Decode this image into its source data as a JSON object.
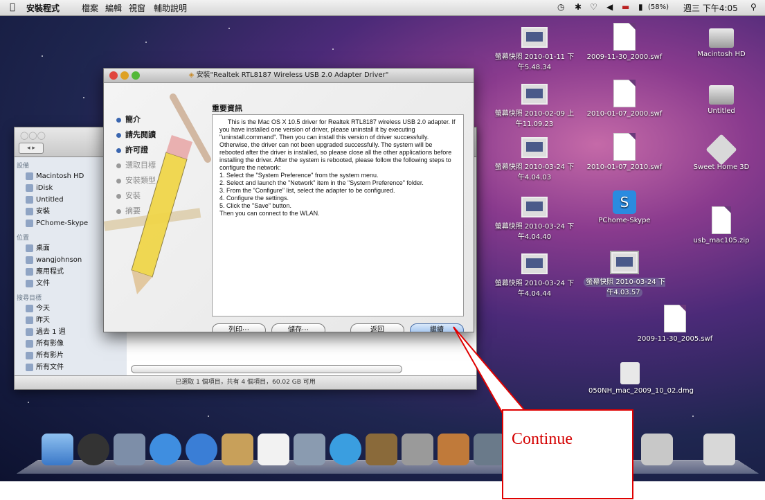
{
  "menubar": {
    "app_name": "安裝程式",
    "items": [
      "檔案",
      "編輯",
      "視窗",
      "輔助說明"
    ],
    "battery": "(58%)",
    "clock": "週三 下午4:05"
  },
  "desktop_icons": [
    {
      "label": "螢幕快照 2010-01-11 下午5.48.34",
      "type": "screenshot"
    },
    {
      "label": "2009-11-30_2000.swf",
      "type": "document"
    },
    {
      "label": "Macintosh HD",
      "type": "disk"
    },
    {
      "label": "螢幕快照 2010-02-09 上午11.09.23",
      "type": "screenshot"
    },
    {
      "label": "2010-01-07_2000.swf",
      "type": "document"
    },
    {
      "label": "Untitled",
      "type": "disk"
    },
    {
      "label": "螢幕快照 2010-03-24 下午4.04.03",
      "type": "screenshot"
    },
    {
      "label": "2010-01-07_2010.swf",
      "type": "document"
    },
    {
      "label": "Sweet Home 3D",
      "type": "app"
    },
    {
      "label": "螢幕快照 2010-03-24 下午4.04.40",
      "type": "screenshot"
    },
    {
      "label": "PChome-Skype",
      "type": "app"
    },
    {
      "label": "usb_mac105.zip",
      "type": "zip"
    },
    {
      "label": "螢幕快照 2010-03-24 下午4.04.44",
      "type": "screenshot"
    },
    {
      "label": "螢幕快照 2010-03-24 下午4.03.57",
      "type": "screenshot"
    },
    {
      "label": "2009-11-30_2005.swf",
      "type": "document"
    },
    {
      "label": "050NH_mac_2009_10_02.dmg",
      "type": "disk-image"
    }
  ],
  "finder": {
    "sidebar": {
      "devices_header": "設備",
      "devices": [
        "Macintosh HD",
        "iDisk",
        "Untitled",
        "安裝",
        "PChome-Skype"
      ],
      "places_header": "位置",
      "places": [
        "桌面",
        "wangjohnson",
        "應用程式",
        "文件"
      ],
      "search_header": "搜尋目標",
      "search": [
        "今天",
        "昨天",
        "過去 1 週",
        "所有影像",
        "所有影片",
        "所有文件"
      ]
    },
    "status": "已選取 1 個項目，共有 4 個項目，60.02 GB 可用"
  },
  "installer": {
    "title": "安裝\"Realtek RTL8187 Wireless USB 2.0 Adapter Driver\"",
    "steps": [
      {
        "label": "簡介",
        "state": "done"
      },
      {
        "label": "請先閱讀",
        "state": "current"
      },
      {
        "label": "許可證",
        "state": "done"
      },
      {
        "label": "選取目標",
        "state": "pending"
      },
      {
        "label": "安裝類型",
        "state": "pending"
      },
      {
        "label": "安裝",
        "state": "pending"
      },
      {
        "label": "摘要",
        "state": "pending"
      }
    ],
    "heading": "重要資訊",
    "body": [
      "This is the Mac OS X 10.5 driver for Realtek RTL8187 wireless USB 2.0 adapter. If you have installed one version of driver, please uninstall it by executing \"uninstall.command\". Then you can install this version of driver successfully. Otherwise, the driver can not been upgraded successfully. The system will be rebooted after the driver is installed, so please close all the other applications before installing the driver. After the system is rebooted, please follow the following steps to configure the network:",
      "1. Select the \"System Preference\" from the system menu.",
      "2. Select and launch the \"Network\" item in the \"System Preference\" folder.",
      "3. From the \"Configure\" list, select the adapter to be configured.",
      "4. Configure the settings.",
      "5. Click the \"Save\" button.",
      "Then you can connect to the WLAN."
    ],
    "buttons": {
      "print": "列印⋯",
      "save": "儲存⋯",
      "back": "返回",
      "continue": "繼續"
    }
  },
  "annotation": {
    "label": "Continue",
    "color": "#e00000"
  }
}
